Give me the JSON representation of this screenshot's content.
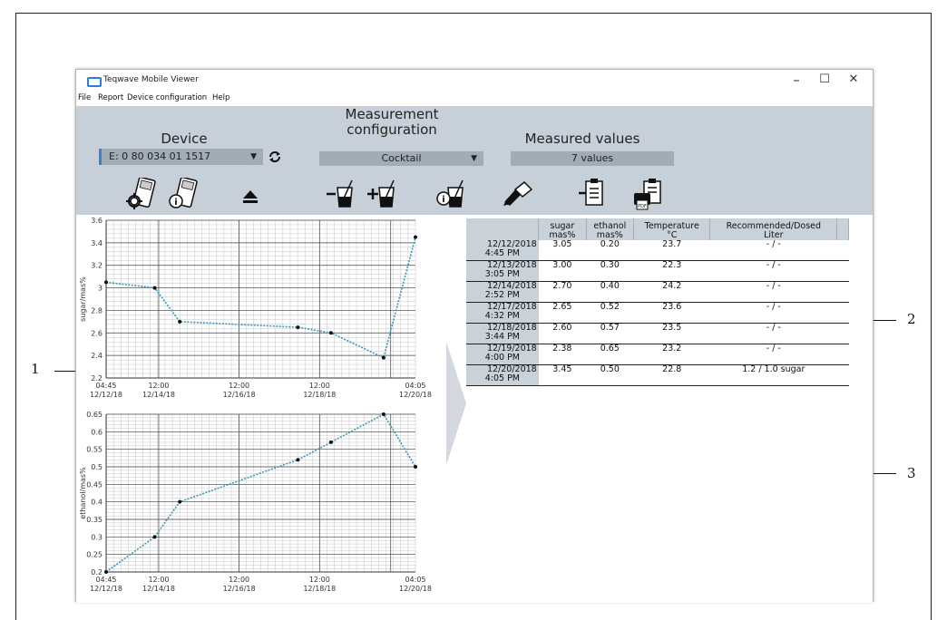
{
  "app": {
    "title": "Teqwave Mobile Viewer"
  },
  "window_controls": {
    "minimize": "–",
    "maximize": "☐",
    "close": "✕"
  },
  "menu": {
    "file": "File",
    "report": "Report",
    "device_config": "Device configuration",
    "help": "Help"
  },
  "toolbar": {
    "device": {
      "title": "Device",
      "selected": "E: 0 80 034 01 1517"
    },
    "measurement": {
      "title_line1": "Measurement",
      "title_line2": "configuration",
      "selected": "Cocktail"
    },
    "measured": {
      "title": "Measured values",
      "count": "7 values"
    }
  },
  "chart_data": [
    {
      "type": "line",
      "ylabel": "sugar/mas%",
      "ylim": [
        2.2,
        3.6
      ],
      "yticks": [
        "3.6",
        "3.4",
        "3.2",
        "3",
        "2.8",
        "2.6",
        "2.4",
        "2.2"
      ],
      "xticks": [
        {
          "time": "04:45",
          "date": "12/12/18"
        },
        {
          "time": "12:00",
          "date": "12/14/18"
        },
        {
          "time": "12:00",
          "date": "12/16/18"
        },
        {
          "time": "12:00",
          "date": "12/18/18"
        },
        {
          "time": "04:05",
          "date": "12/20/18"
        }
      ],
      "series": [
        {
          "values": [
            3.05,
            3.0,
            2.7,
            2.65,
            2.6,
            2.38,
            3.45
          ]
        }
      ],
      "grid": true
    },
    {
      "type": "line",
      "ylabel": "ethanol/mas%",
      "ylim": [
        0.2,
        0.65
      ],
      "yticks": [
        "0.65",
        "0.6",
        "0.55",
        "0.5",
        "0.45",
        "0.4",
        "0.35",
        "0.3",
        "0.25",
        "0.2"
      ],
      "xticks": [
        {
          "time": "04:45",
          "date": "12/12/18"
        },
        {
          "time": "12:00",
          "date": "12/14/18"
        },
        {
          "time": "12:00",
          "date": "12/16/18"
        },
        {
          "time": "12:00",
          "date": "12/18/18"
        },
        {
          "time": "04:05",
          "date": "12/20/18"
        }
      ],
      "series": [
        {
          "values": [
            0.2,
            0.3,
            0.4,
            0.52,
            0.57,
            0.65,
            0.5
          ]
        }
      ],
      "grid": true
    }
  ],
  "table": {
    "headers": [
      {
        "l1": "",
        "l2": ""
      },
      {
        "l1": "sugar",
        "l2": "mas%"
      },
      {
        "l1": "ethanol",
        "l2": "mas%"
      },
      {
        "l1": "Temperature",
        "l2": "°C"
      },
      {
        "l1": "Recommended/Dosed",
        "l2": "Liter"
      }
    ],
    "rows": [
      {
        "date": "12/12/2018",
        "time": "4:45 PM",
        "sugar": "3.05",
        "ethanol": "0.20",
        "temp": "23.7",
        "rec": "- / -"
      },
      {
        "date": "12/13/2018",
        "time": "3:05 PM",
        "sugar": "3.00",
        "ethanol": "0.30",
        "temp": "22.3",
        "rec": "- / -"
      },
      {
        "date": "12/14/2018",
        "time": "2:52 PM",
        "sugar": "2.70",
        "ethanol": "0.40",
        "temp": "24.2",
        "rec": "- / -"
      },
      {
        "date": "12/17/2018",
        "time": "4:32 PM",
        "sugar": "2.65",
        "ethanol": "0.52",
        "temp": "23.6",
        "rec": "- / -"
      },
      {
        "date": "12/18/2018",
        "time": "3:44 PM",
        "sugar": "2.60",
        "ethanol": "0.57",
        "temp": "23.5",
        "rec": "- / -"
      },
      {
        "date": "12/19/2018",
        "time": "4:00 PM",
        "sugar": "2.38",
        "ethanol": "0.65",
        "temp": "23.2",
        "rec": "- / -"
      },
      {
        "date": "12/20/2018",
        "time": "4:05 PM",
        "sugar": "3.45",
        "ethanol": "0.50",
        "temp": "22.8",
        "rec": "1.2 / 1.0 sugar"
      }
    ]
  },
  "callouts": [
    "1",
    "2",
    "3"
  ],
  "icons": {
    "refresh": "refresh-icon",
    "eject": "eject-icon",
    "pdf": "PDF"
  },
  "colors": {
    "toolbar_bg": "#c7d0d8",
    "series_line": "#3a98b8",
    "accent": "#2b7cd3"
  }
}
